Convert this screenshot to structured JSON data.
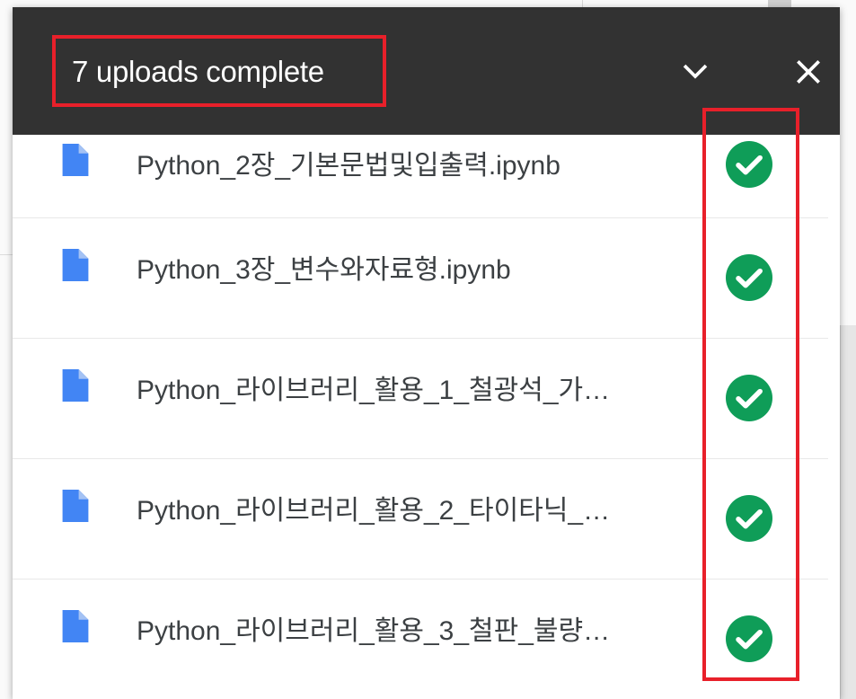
{
  "panel": {
    "title": "7 uploads complete"
  },
  "files": [
    {
      "name": "Python_2장_기본문법및입출력.ipynb",
      "status": "complete"
    },
    {
      "name": "Python_3장_변수와자료형.ipynb",
      "status": "complete"
    },
    {
      "name": "Python_라이브러리_활용_1_철광석_가…",
      "status": "complete"
    },
    {
      "name": "Python_라이브러리_활용_2_타이타닉_…",
      "status": "complete"
    },
    {
      "name": "Python_라이브러리_활용_3_철판_불량…",
      "status": "complete"
    }
  ],
  "colors": {
    "header_bg": "#323232",
    "file_icon": "#4285f4",
    "success": "#0f9d58",
    "highlight": "#e8202a"
  },
  "icons": {
    "collapse": "chevron-down-icon",
    "close": "close-icon",
    "file": "file-icon",
    "status": "check-circle-icon"
  }
}
